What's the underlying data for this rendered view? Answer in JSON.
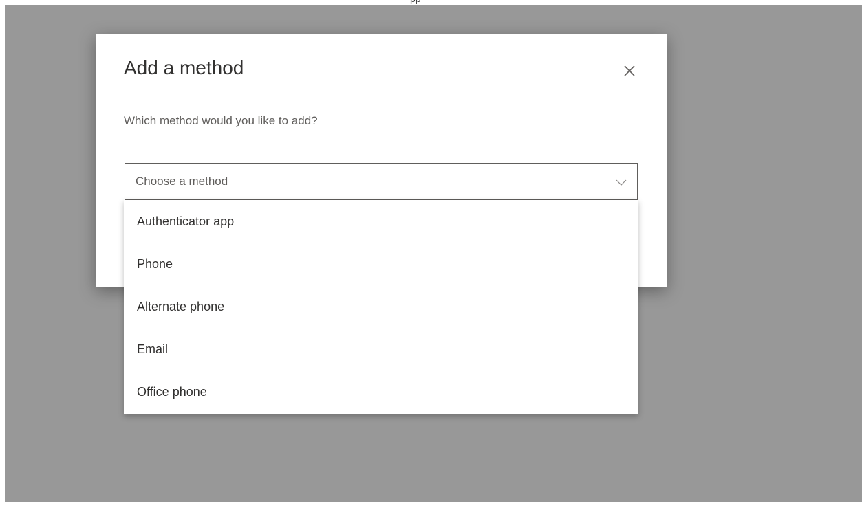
{
  "dialog": {
    "title": "Add a method",
    "question": "Which method would you like to add?",
    "select": {
      "selected_label": "Choose a method",
      "options": [
        "Authenticator app",
        "Phone",
        "Alternate phone",
        "Email",
        "Office phone"
      ]
    }
  },
  "colors": {
    "overlay": "#989898",
    "dialog_bg": "#ffffff",
    "title_text": "#323130",
    "muted_text": "#605e5c"
  },
  "icons": {
    "close": "close-icon",
    "dropdown": "chevron-down-icon"
  }
}
